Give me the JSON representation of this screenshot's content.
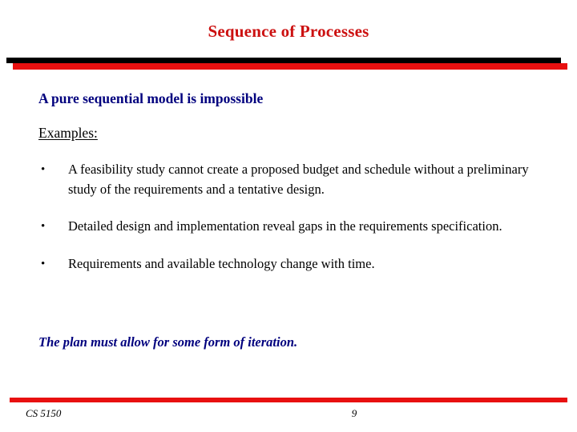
{
  "slide": {
    "title": "Sequence of Processes",
    "title_color": "#cc1111",
    "accent_red": "#e81010",
    "accent_navy": "#00007e",
    "lead_heading": "A pure sequential model is impossible",
    "examples_label": "Examples:",
    "bullet_marker": "•",
    "bullets": [
      {
        "text": "A feasibility study cannot create a proposed budget and schedule without a preliminary study of the requirements and a tentative design."
      },
      {
        "text": "Detailed design and implementation reveal gaps in the requirements specification."
      },
      {
        "text": "Requirements and available technology change with time."
      }
    ],
    "closing_note": "The plan must allow for some form of iteration.",
    "footer": {
      "course": "CS 5150",
      "page_number": "9"
    }
  }
}
